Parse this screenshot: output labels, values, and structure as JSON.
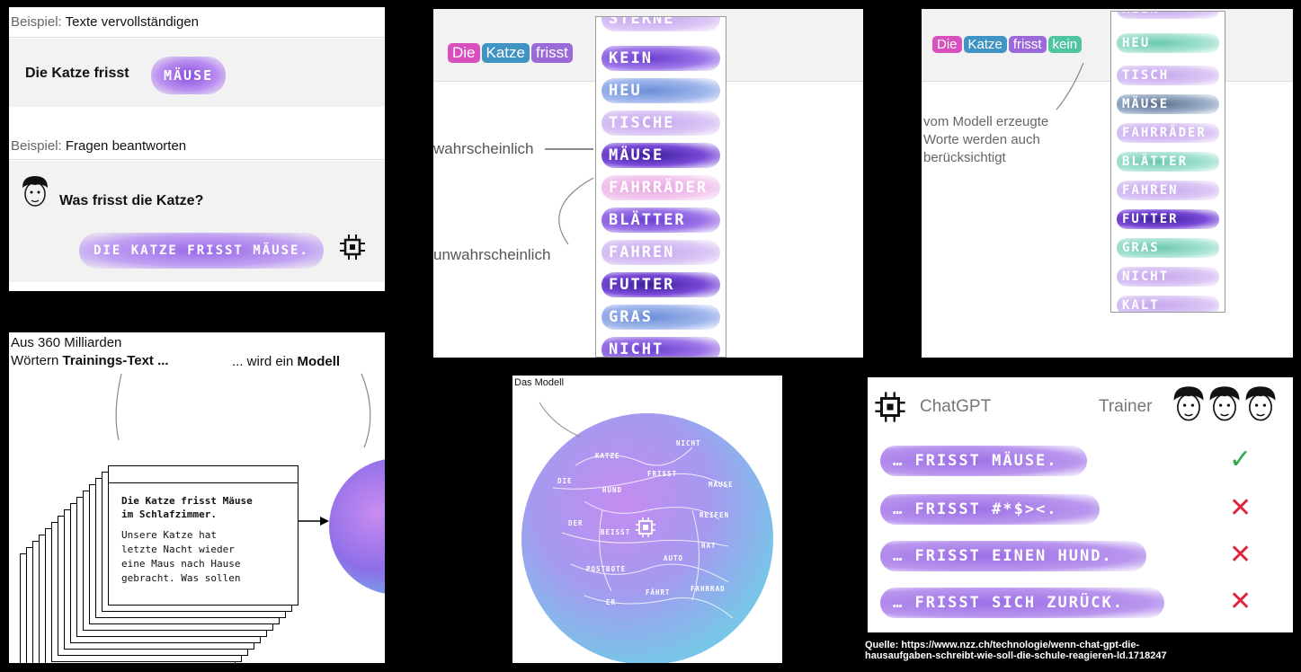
{
  "panel1": {
    "ex1_label": "Beispiel:",
    "ex1_title": "Texte vervollständigen",
    "ex1_sentence": "Die Katze frisst",
    "ex1_word": "MÄUSE",
    "ex2_label": "Beispiel:",
    "ex2_title": "Fragen beantworten",
    "question": "Was frisst die Katze?",
    "answer": "DIE KATZE FRISST MÄUSE."
  },
  "panel2": {
    "tokens": [
      "Die",
      "Katze",
      "frisst"
    ],
    "words": [
      "STERNE",
      "KEIN",
      "HEU",
      "TISCHE",
      "MÄUSE",
      "FAHRRÄDER",
      "BLÄTTER",
      "FAHREN",
      "FUTTER",
      "GRAS",
      "NICHT"
    ],
    "likely_label": "wahrscheinlich",
    "unlikely_label": "unwahrscheinlich"
  },
  "panel3": {
    "tokens": [
      "Die",
      "Katze",
      "frisst",
      "kein"
    ],
    "words": [
      "KEIN",
      "HEU",
      "TISCH",
      "MÄUSE",
      "FAHRRÄDER",
      "BLÄTTER",
      "FAHREN",
      "FUTTER",
      "GRAS",
      "NICHT",
      "KALT"
    ],
    "note_line1": "vom Modell erzeugte",
    "note_line2": "Worte werden auch",
    "note_line3": "berücksichtigt"
  },
  "panel4": {
    "heading_line1": "Aus 360 Milliarden",
    "heading_line2_prefix": "Wörtern ",
    "heading_line2_bold": "Trainings-Text ...",
    "heading_model_prefix": "... wird ein ",
    "heading_model_bold": "Modell",
    "doc_title_line1": "Die Katze frisst Mäuse",
    "doc_title_line2": "im Schlafzimmer.",
    "doc_body": [
      "Unsere Katze hat",
      "letzte Nacht wieder",
      "eine Maus nach Hause",
      "gebracht. Was sollen"
    ]
  },
  "panel5": {
    "title": "Das Modell",
    "words": [
      "NICHT",
      "KATZE",
      "FRISST",
      "DIE",
      "HUND",
      "MÄUSE",
      "REIFEN",
      "DER",
      "BEISST",
      "HAT",
      "AUTO",
      "POSTBOTE",
      "FÄHRT",
      "FAHRRAD",
      "ER"
    ]
  },
  "panel6": {
    "chatgpt_label": "ChatGPT",
    "trainer_label": "Trainer",
    "rows": [
      {
        "text": "… FRISST MÄUSE.",
        "verdict": "check"
      },
      {
        "text": "… FRISST #*$><.",
        "verdict": "cross"
      },
      {
        "text": "… FRISST EINEN HUND.",
        "verdict": "cross"
      },
      {
        "text": "… FRISST SICH ZURÜCK.",
        "verdict": "cross"
      }
    ],
    "check_glyph": "✓",
    "cross_glyph": "✕",
    "colors": {
      "check": "#2fa84f",
      "cross": "#e0243c",
      "glow": "#a77bea"
    }
  },
  "source": {
    "line1": "Quelle: https://www.nzz.ch/technologie/wenn-chat-gpt-die-",
    "line2": "hausaufgaben-schreibt-wie-soll-die-schule-reagieren-ld.1718247"
  }
}
